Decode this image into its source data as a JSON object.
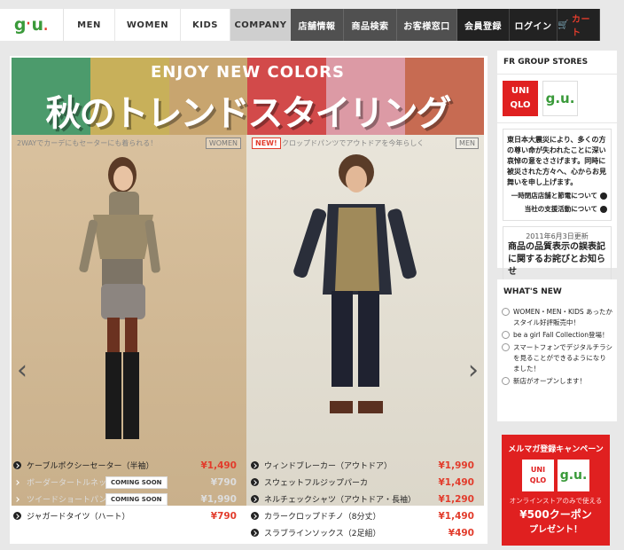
{
  "nav": {
    "logo": "g.u.",
    "men": "MEN",
    "women": "WOMEN",
    "kids": "KIDS",
    "company": "COMPANY",
    "store": "店舗情報",
    "search": "商品検索",
    "support": "お客様窓口",
    "member": "会員登録",
    "login": "ログイン",
    "cart": "カート"
  },
  "colors": {
    "green": "#3a9a3a",
    "red": "#e23c2c"
  },
  "banner": {
    "enjoy": "ENJOY NEW COLORS",
    "trend": "秋のトレンドスタイリング",
    "stripes": [
      "#4c9b6c",
      "#c8b05a",
      "#c8a56f",
      "#d24a4a",
      "#dc9aa5",
      "#c76b52"
    ]
  },
  "left": {
    "caption": "2WAYでカーデにもセーターにも着られる！",
    "tag": "WOMEN"
  },
  "right": {
    "new": "NEW!",
    "caption": "クロップドパンツでアウトドアを今年らしく",
    "tag": "MEN"
  },
  "products_left": [
    {
      "name": "ケーブルポクシーセーター（半袖）",
      "price": "¥1,490"
    },
    {
      "name": "ボーダータートルネック",
      "price": "¥790",
      "badge": "COMING SOON"
    },
    {
      "name": "ツイードショートパンツ",
      "price": "¥1,990",
      "badge": "COMING SOON"
    },
    {
      "name": "ジャガードタイツ（ハート）",
      "price": "¥790"
    }
  ],
  "products_right": [
    {
      "name": "ウィンドブレーカー（アウトドア）",
      "price": "¥1,990"
    },
    {
      "name": "スウェットフルジップパーカ",
      "price": "¥1,490"
    },
    {
      "name": "ネルチェックシャツ（アウトドア・長袖）",
      "price": "¥1,290"
    },
    {
      "name": "カラークロップドチノ（8分丈）",
      "price": "¥1,490"
    },
    {
      "name": "スラブラインソックス（2足組）",
      "price": "¥490"
    }
  ],
  "side": {
    "stores_title": "FR GROUP STORES",
    "uniqlo": "UNI QLO",
    "gu": "g.u.",
    "quake": "東日本大震災により、多くの方の尊い命が失われたことに深い哀悼の意をささげます。同時に被災された方々へ、心からお見舞いを申し上げます。",
    "link1": "一時閉店店舗と節電について",
    "link2": "当社の支援活動について",
    "notice_date": "2011年6月3日更新",
    "notice_text": "商品の品質表示の誤表記に関するお詫びとお知らせ",
    "whats_title": "WHAT'S NEW",
    "whats": [
      "WOMEN・MEN・KIDS あったかスタイル好評販売中！",
      "be a girl Fall Collection登場！",
      "スマートフォンでデジタルチラシを見ることができるようになりました！",
      "新店がオープンします！"
    ],
    "mail_title": "メルマガ登録キャンペーン",
    "mail_online": "オンラインストアのみで使える",
    "mail_coupon": "¥500クーポン",
    "mail_present": "プレゼント！"
  }
}
